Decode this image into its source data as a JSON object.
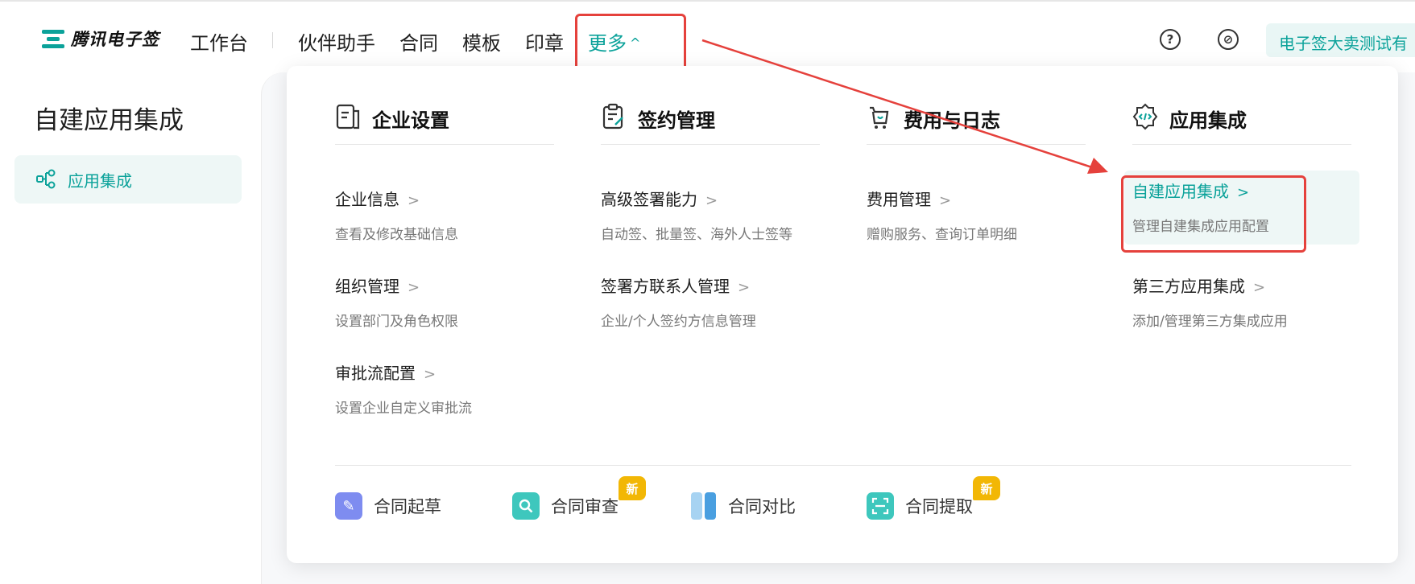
{
  "brand": {
    "name": "腾讯电子签"
  },
  "nav": {
    "items": [
      {
        "label": "工作台"
      },
      {
        "label": "伙伴助手"
      },
      {
        "label": "合同"
      },
      {
        "label": "模板"
      },
      {
        "label": "印章"
      }
    ],
    "more": {
      "label": "更多",
      "chevron": "^"
    }
  },
  "header": {
    "help_icon": "?",
    "link_icon": "⊘",
    "account": "电子签大卖测试有"
  },
  "sidebar": {
    "title": "自建应用集成",
    "items": [
      {
        "label": "应用集成",
        "icon": "share-nodes-icon"
      }
    ]
  },
  "menu": {
    "columns": [
      {
        "title": "企业设置",
        "icon": "document-icon",
        "entries": [
          {
            "title": "企业信息",
            "desc": "查看及修改基础信息"
          },
          {
            "title": "组织管理",
            "desc": "设置部门及角色权限"
          },
          {
            "title": "审批流配置",
            "desc": "设置企业自定义审批流"
          }
        ]
      },
      {
        "title": "签约管理",
        "icon": "clipboard-sign-icon",
        "entries": [
          {
            "title": "高级签署能力",
            "desc": "自动签、批量签、海外人士签等"
          },
          {
            "title": "签署方联系人管理",
            "desc": "企业/个人签约方信息管理"
          }
        ]
      },
      {
        "title": "费用与日志",
        "icon": "cart-icon",
        "entries": [
          {
            "title": "费用管理",
            "desc": "赠购服务、查询订单明细"
          }
        ]
      },
      {
        "title": "应用集成",
        "icon": "code-gear-icon",
        "entries": [
          {
            "title": "自建应用集成",
            "desc": "管理自建集成应用配置"
          },
          {
            "title": "第三方应用集成",
            "desc": "添加/管理第三方集成应用"
          }
        ]
      }
    ],
    "arrow": ">",
    "tools": [
      {
        "label": "合同起草",
        "color": "#7e8cf0",
        "badge": ""
      },
      {
        "label": "合同审查",
        "color": "#3ec7bd",
        "badge": "新"
      },
      {
        "label": "合同对比",
        "color": "#6aaee8",
        "badge": ""
      },
      {
        "label": "合同提取",
        "color": "#3ec7bd",
        "badge": "新"
      }
    ]
  },
  "colors": {
    "accent": "#0ba29a",
    "highlight": "#e5413c",
    "badge": "#f2b705"
  }
}
